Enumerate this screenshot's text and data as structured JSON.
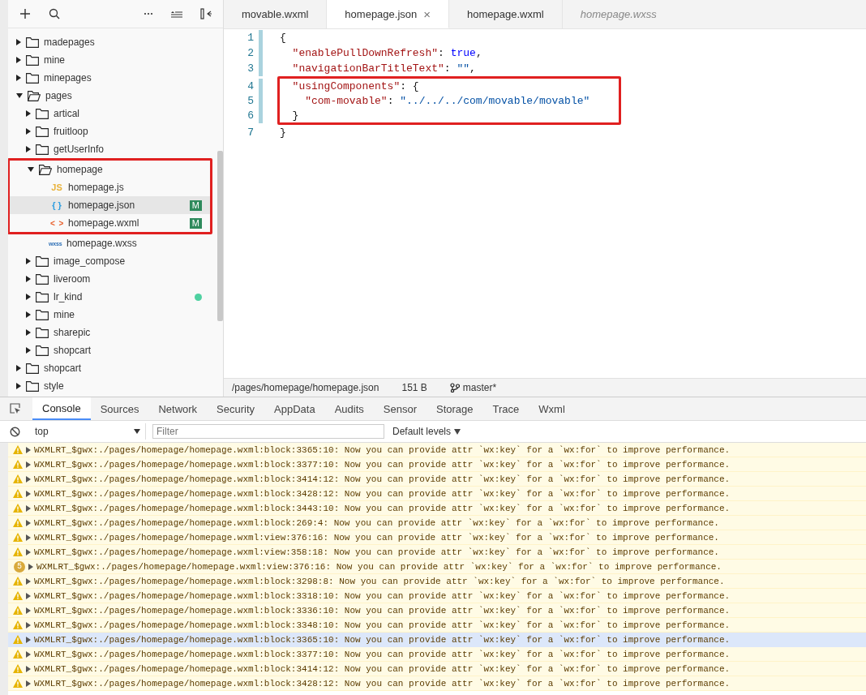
{
  "sidebar": {
    "tree": [
      {
        "name": "madepages",
        "kind": "folder",
        "expanded": false
      },
      {
        "name": "mine",
        "kind": "folder",
        "expanded": false
      },
      {
        "name": "minepages",
        "kind": "folder",
        "expanded": false
      },
      {
        "name": "pages",
        "kind": "folder",
        "expanded": true,
        "children": [
          {
            "name": "artical",
            "kind": "folder",
            "expanded": false
          },
          {
            "name": "fruitloop",
            "kind": "folder",
            "expanded": false
          },
          {
            "name": "getUserInfo",
            "kind": "folder",
            "expanded": false
          },
          {
            "name": "homepage",
            "kind": "folder",
            "expanded": true,
            "boxed": true,
            "children": [
              {
                "name": "homepage.js",
                "kind": "js",
                "glyph": "JS",
                "selected": false,
                "boxed": true
              },
              {
                "name": "homepage.json",
                "kind": "json",
                "glyph": "{ }",
                "selected": true,
                "badge": "M",
                "boxed": true
              },
              {
                "name": "homepage.wxml",
                "kind": "wxml",
                "glyph": "< >",
                "selected": false,
                "badge": "M",
                "boxed": true
              },
              {
                "name": "homepage.wxss",
                "kind": "wxss",
                "glyph": "wxss",
                "selected": false
              }
            ]
          },
          {
            "name": "image_compose",
            "kind": "folder",
            "expanded": false
          },
          {
            "name": "liveroom",
            "kind": "folder",
            "expanded": false
          },
          {
            "name": "lr_kind",
            "kind": "folder",
            "expanded": false,
            "color": "#4fd1a1"
          },
          {
            "name": "mine",
            "kind": "folder",
            "expanded": false
          },
          {
            "name": "sharepic",
            "kind": "folder",
            "expanded": false
          },
          {
            "name": "shopcart",
            "kind": "folder",
            "expanded": false
          }
        ]
      },
      {
        "name": "shopcart",
        "kind": "folder",
        "expanded": false
      },
      {
        "name": "style",
        "kind": "folder",
        "expanded": false
      }
    ]
  },
  "editor": {
    "tabs": [
      {
        "label": "movable.wxml",
        "selected": false,
        "preview": false
      },
      {
        "label": "homepage.json",
        "selected": true,
        "preview": false,
        "close": "×"
      },
      {
        "label": "homepage.wxml",
        "selected": false,
        "preview": false
      },
      {
        "label": "homepage.wxss",
        "selected": false,
        "preview": true
      }
    ],
    "lines": [
      {
        "number": "1",
        "modified": true,
        "tokens": [
          {
            "kind": "punct",
            "text": "{"
          }
        ],
        "children": [
          {
            "number": "2",
            "modified": true,
            "tokens": [
              {
                "kind": "key",
                "text": "\"enablePullDownRefresh\""
              },
              {
                "kind": "punct",
                "text": ":"
              },
              {
                "kind": "keyword",
                "text": "true"
              },
              {
                "kind": "punct",
                "text": ","
              }
            ]
          },
          {
            "number": "3",
            "modified": true,
            "tokens": [
              {
                "kind": "key",
                "text": "\"navigationBarTitleText\""
              },
              {
                "kind": "punct",
                "text": ":"
              },
              {
                "kind": "string",
                "text": "\"\""
              },
              {
                "kind": "punct",
                "text": ","
              }
            ]
          },
          {
            "number": "4",
            "modified": true,
            "boxed": true,
            "tokens": [
              {
                "kind": "key",
                "text": "\"usingComponents\""
              },
              {
                "kind": "punct",
                "text": ":"
              },
              {
                "kind": "punct",
                "text": "{"
              }
            ],
            "children": [
              {
                "number": "5",
                "modified": true,
                "boxed": true,
                "tokens": [
                  {
                    "kind": "key",
                    "text": "\"com-movable\""
                  },
                  {
                    "kind": "punct",
                    "text": ":"
                  },
                  {
                    "kind": "string",
                    "text": "\"../../../com/movable/movable\""
                  }
                ]
              }
            ]
          },
          {
            "number": "6",
            "modified": true,
            "boxed": true,
            "tokens": [
              {
                "kind": "punct",
                "text": "}"
              }
            ]
          }
        ]
      },
      {
        "number": "7",
        "modified": false,
        "tokens": [
          {
            "kind": "punct",
            "text": "}"
          }
        ]
      }
    ],
    "status_bar": {
      "path": "/pages/homepage/homepage.json",
      "size": "151 B",
      "branch": "master*"
    }
  },
  "console": {
    "tabs": [
      {
        "label": "Console",
        "selected": true
      },
      {
        "label": "Sources",
        "selected": false
      },
      {
        "label": "Network",
        "selected": false
      },
      {
        "label": "Security",
        "selected": false
      },
      {
        "label": "AppData",
        "selected": false
      },
      {
        "label": "Audits",
        "selected": false
      },
      {
        "label": "Sensor",
        "selected": false
      },
      {
        "label": "Storage",
        "selected": false
      },
      {
        "label": "Trace",
        "selected": false
      },
      {
        "label": "Wxml",
        "selected": false
      }
    ],
    "context": "top",
    "filter_placeholder": "Filter",
    "levels": "Default levels",
    "messages": [
      {
        "kind": "warning",
        "selected": false,
        "text": "WXMLRT_$gwx:./pages/homepage/homepage.wxml:block:3365:10: Now you can provide attr `wx:key` for a `wx:for` to improve performance."
      },
      {
        "kind": "warning",
        "selected": false,
        "text": "WXMLRT_$gwx:./pages/homepage/homepage.wxml:block:3377:10: Now you can provide attr `wx:key` for a `wx:for` to improve performance."
      },
      {
        "kind": "warning",
        "selected": false,
        "text": "WXMLRT_$gwx:./pages/homepage/homepage.wxml:block:3414:12: Now you can provide attr `wx:key` for a `wx:for` to improve performance."
      },
      {
        "kind": "warning",
        "selected": false,
        "text": "WXMLRT_$gwx:./pages/homepage/homepage.wxml:block:3428:12: Now you can provide attr `wx:key` for a `wx:for` to improve performance."
      },
      {
        "kind": "warning",
        "selected": false,
        "text": "WXMLRT_$gwx:./pages/homepage/homepage.wxml:block:3443:10: Now you can provide attr `wx:key` for a `wx:for` to improve performance."
      },
      {
        "kind": "warning",
        "selected": false,
        "text": "WXMLRT_$gwx:./pages/homepage/homepage.wxml:block:269:4: Now you can provide attr `wx:key` for a `wx:for` to improve performance."
      },
      {
        "kind": "warning",
        "selected": false,
        "text": "WXMLRT_$gwx:./pages/homepage/homepage.wxml:view:376:16: Now you can provide attr `wx:key` for a `wx:for` to improve performance."
      },
      {
        "kind": "warning",
        "selected": false,
        "text": "WXMLRT_$gwx:./pages/homepage/homepage.wxml:view:358:18: Now you can provide attr `wx:key` for a `wx:for` to improve performance."
      },
      {
        "kind": "repeated",
        "count": "5",
        "selected": false,
        "text": "WXMLRT_$gwx:./pages/homepage/homepage.wxml:view:376:16: Now you can provide attr `wx:key` for a `wx:for` to improve performance."
      },
      {
        "kind": "warning",
        "selected": false,
        "text": "WXMLRT_$gwx:./pages/homepage/homepage.wxml:block:3298:8: Now you can provide attr `wx:key` for a `wx:for` to improve performance."
      },
      {
        "kind": "warning",
        "selected": false,
        "text": "WXMLRT_$gwx:./pages/homepage/homepage.wxml:block:3318:10: Now you can provide attr `wx:key` for a `wx:for` to improve performance."
      },
      {
        "kind": "warning",
        "selected": false,
        "text": "WXMLRT_$gwx:./pages/homepage/homepage.wxml:block:3336:10: Now you can provide attr `wx:key` for a `wx:for` to improve performance."
      },
      {
        "kind": "warning",
        "selected": false,
        "text": "WXMLRT_$gwx:./pages/homepage/homepage.wxml:block:3348:10: Now you can provide attr `wx:key` for a `wx:for` to improve performance."
      },
      {
        "kind": "warning",
        "selected": true,
        "text": "WXMLRT_$gwx:./pages/homepage/homepage.wxml:block:3365:10: Now you can provide attr `wx:key` for a `wx:for` to improve performance."
      },
      {
        "kind": "warning",
        "selected": false,
        "text": "WXMLRT_$gwx:./pages/homepage/homepage.wxml:block:3377:10: Now you can provide attr `wx:key` for a `wx:for` to improve performance."
      },
      {
        "kind": "warning",
        "selected": false,
        "text": "WXMLRT_$gwx:./pages/homepage/homepage.wxml:block:3414:12: Now you can provide attr `wx:key` for a `wx:for` to improve performance."
      },
      {
        "kind": "warning",
        "selected": false,
        "text": "WXMLRT_$gwx:./pages/homepage/homepage.wxml:block:3428:12: Now you can provide attr `wx:key` for a `wx:for` to improve performance."
      }
    ]
  }
}
